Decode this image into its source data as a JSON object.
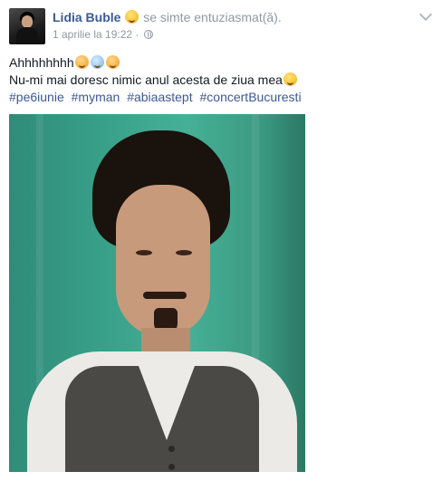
{
  "post": {
    "author": "Lidia Buble",
    "feeling_text": "se simte entuziasmat(ă).",
    "date": "1 aprilie la 19:22",
    "separator": "·",
    "lines": [
      "Ahhhhhhhh",
      "Nu-mi mai doresc nimic anul acesta de ziua mea"
    ],
    "hashtags": [
      "#pe6iunie",
      "#myman",
      "#abiaastept",
      "#concertBucuresti"
    ],
    "icons": {
      "feeling": "grinning-face-emoji",
      "privacy": "globe-icon",
      "options": "chevron-down-icon",
      "line1_emojis": [
        "heart-eyes-emoji",
        "screaming-face-emoji",
        "heart-eyes-emoji"
      ],
      "line2_emoji": "laughing-face-emoji"
    },
    "colors": {
      "author": "#3b5998",
      "meta": "#9197a3",
      "wall": "#3aa28a"
    }
  }
}
